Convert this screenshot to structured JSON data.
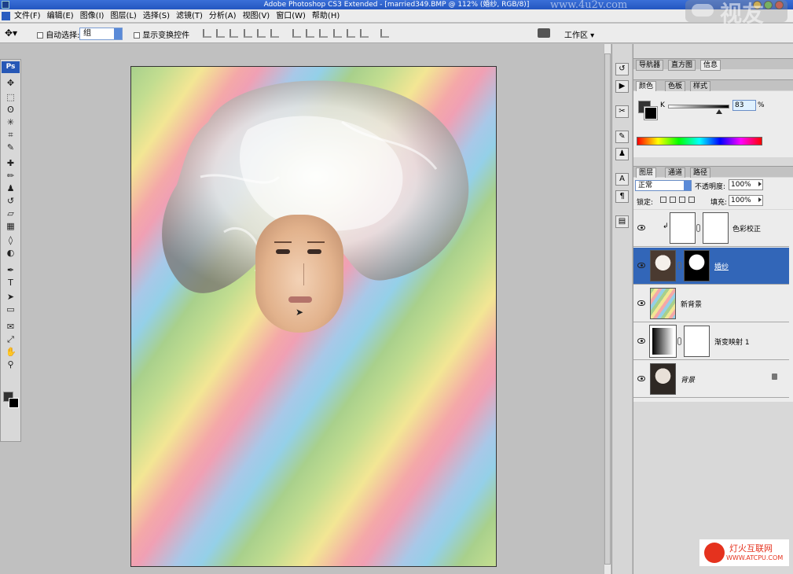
{
  "window": {
    "title": "Adobe Photoshop CS3 Extended - [married349.BMP @ 112% (婚纱, RGB/8)]",
    "watermark": "www.4u2v.com"
  },
  "menu": [
    "文件(F)",
    "编辑(E)",
    "图像(I)",
    "图层(L)",
    "选择(S)",
    "滤镜(T)",
    "分析(A)",
    "视图(V)",
    "窗口(W)",
    "帮助(H)"
  ],
  "brand_logo": "视友",
  "options": {
    "auto_select_label": "自动选择:",
    "auto_select_value": "组",
    "show_transform_label": "显示变换控件",
    "workspace_label": "工作区 ▾"
  },
  "tools_logo": "Ps",
  "tools": [
    {
      "name": "move-tool",
      "glyph": "✥"
    },
    {
      "name": "marquee-tool",
      "glyph": "⬚"
    },
    {
      "name": "lasso-tool",
      "glyph": "ʘ"
    },
    {
      "name": "magic-wand-tool",
      "glyph": "✳"
    },
    {
      "name": "crop-tool",
      "glyph": "⌗"
    },
    {
      "name": "slice-tool",
      "glyph": "✎"
    },
    {
      "name": "healing-brush-tool",
      "glyph": "✚"
    },
    {
      "name": "brush-tool",
      "glyph": "✏"
    },
    {
      "name": "clone-stamp-tool",
      "glyph": "♟"
    },
    {
      "name": "history-brush-tool",
      "glyph": "↺"
    },
    {
      "name": "eraser-tool",
      "glyph": "▱"
    },
    {
      "name": "gradient-tool",
      "glyph": "▦"
    },
    {
      "name": "blur-tool",
      "glyph": "◊"
    },
    {
      "name": "dodge-tool",
      "glyph": "◐"
    },
    {
      "name": "pen-tool",
      "glyph": "✒"
    },
    {
      "name": "type-tool",
      "glyph": "T"
    },
    {
      "name": "path-selection-tool",
      "glyph": "➤"
    },
    {
      "name": "shape-tool",
      "glyph": "▭"
    },
    {
      "name": "notes-tool",
      "glyph": "✉"
    },
    {
      "name": "eyedropper-tool",
      "glyph": "⤢"
    },
    {
      "name": "hand-tool",
      "glyph": "✋"
    },
    {
      "name": "zoom-tool",
      "glyph": "⚲"
    }
  ],
  "panels": {
    "nav_tabs": [
      "导航器",
      "直方图",
      "信息"
    ],
    "color_tabs": [
      "颜色",
      "色板",
      "样式"
    ],
    "color": {
      "channel_label": "K",
      "value": "83",
      "unit": "%",
      "slider_fraction": 0.83
    },
    "layer_tabs": [
      "图层",
      "通道",
      "路径"
    ],
    "blend_mode": "正常",
    "opacity_label": "不透明度:",
    "opacity_value": "100%",
    "lock_label": "锁定:",
    "fill_label": "填充:",
    "fill_value": "100%"
  },
  "layers": [
    {
      "name": "色彩校正",
      "selected": false,
      "type": "adjustment-curves"
    },
    {
      "name": "婚纱",
      "selected": true,
      "type": "image-mask"
    },
    {
      "name": "新背景",
      "selected": false,
      "type": "rainbow"
    },
    {
      "name": "渐变映射 1",
      "selected": false,
      "type": "adjustment-gradient"
    },
    {
      "name": "背景",
      "selected": false,
      "type": "background-locked"
    }
  ],
  "site_logo": {
    "name": "灯火互联网",
    "url": "WWW.ATCPU.COM"
  }
}
